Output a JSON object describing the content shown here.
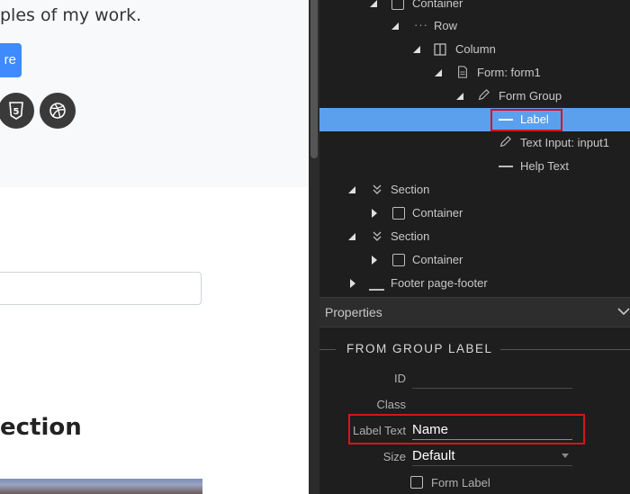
{
  "canvas": {
    "hero_text": "ples of my work.",
    "hero_button": "re",
    "social_icons": [
      "html5-icon",
      "dribbble-icon"
    ],
    "section_heading": "ection"
  },
  "tree": {
    "items": [
      {
        "label": "Container",
        "icon": "container-icon"
      },
      {
        "label": "Row",
        "icon": "row-icon"
      },
      {
        "label": "Column",
        "icon": "column-icon"
      },
      {
        "label": "Form: form1",
        "icon": "form-icon"
      },
      {
        "label": "Form Group",
        "icon": "pencil-icon"
      },
      {
        "label": "Label",
        "icon": "label-icon",
        "selected": true
      },
      {
        "label": "Text Input: input1",
        "icon": "pencil-icon"
      },
      {
        "label": "Help Text",
        "icon": "label-icon"
      },
      {
        "label": "Section",
        "icon": "section-icon"
      },
      {
        "label": "Container",
        "icon": "container-icon"
      },
      {
        "label": "Section",
        "icon": "section-icon"
      },
      {
        "label": "Container",
        "icon": "container-icon"
      },
      {
        "label": "Footer page-footer",
        "icon": "footer-icon"
      }
    ]
  },
  "properties": {
    "title": "Properties",
    "group_title": "FROM GROUP LABEL",
    "fields": {
      "id_label": "ID",
      "id_value": "",
      "class_label": "Class",
      "class_value": "",
      "label_text_label": "Label Text",
      "label_text_value": "Name",
      "size_label": "Size",
      "size_value": "Default"
    },
    "checkbox_label": "Form Label"
  },
  "colors": {
    "selection": "#5ba0ec",
    "highlight_box": "#d9131d",
    "panel_bg": "#1e1e1e",
    "accent_button": "#3d8bfd"
  }
}
